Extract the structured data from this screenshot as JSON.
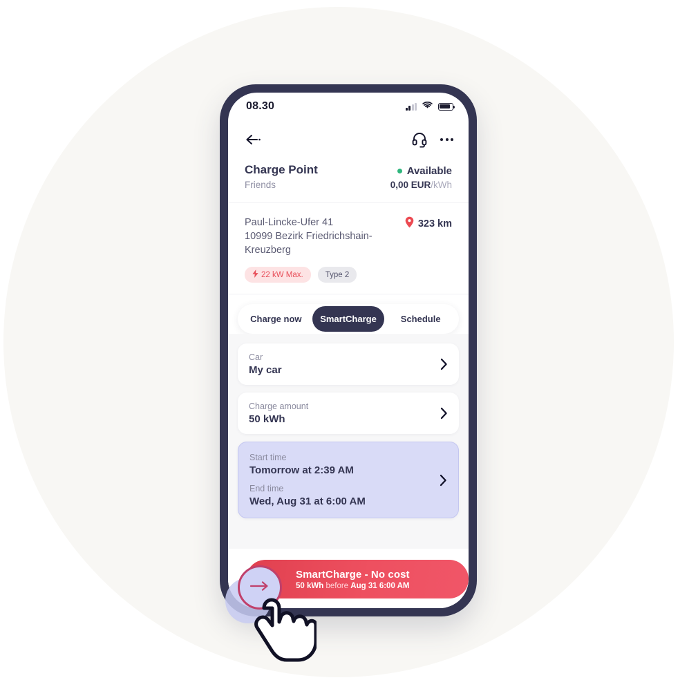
{
  "colors": {
    "backdrop": "#f8f7f4",
    "phone_frame": "#343552",
    "accent_navy": "#343552",
    "accent_red": "#ee5060",
    "available_green": "#2eb67d",
    "highlight_lavender": "#d9dbf7",
    "pill_pink_bg": "#fde3e4",
    "pill_pink_text": "#e8505b",
    "pill_gray_bg": "#e9e9ed",
    "muted_text": "#8a8a9e"
  },
  "status_bar": {
    "time": "08.30",
    "signal_icon": "signal-bars-icon",
    "wifi_icon": "wifi-icon",
    "battery_icon": "battery-icon"
  },
  "navbar": {
    "back_icon": "back-arrow-icon",
    "support_icon": "headset-icon",
    "more_icon": "more-options-icon"
  },
  "header": {
    "title": "Charge Point",
    "subtitle": "Friends",
    "status": "Available",
    "status_dot_icon": "status-dot-icon",
    "price_amount": "0,00 EUR",
    "price_unit": "/kWh"
  },
  "location": {
    "address_line1": "Paul-Lincke-Ufer 41",
    "address_line2": "10999 Bezirk Friedrichshain-",
    "address_line3": "Kreuzberg",
    "distance": "323 km",
    "pin_icon": "map-pin-icon",
    "pills": [
      {
        "label": "22 kW Max.",
        "icon": "lightning-bolt-icon",
        "style": "power"
      },
      {
        "label": "Type 2",
        "icon": "",
        "style": "plug"
      }
    ]
  },
  "tabs": [
    {
      "label": "Charge now",
      "active": false
    },
    {
      "label": "SmartCharge",
      "active": true
    },
    {
      "label": "Schedule",
      "active": false
    }
  ],
  "form": {
    "car": {
      "label": "Car",
      "value": "My car",
      "chevron_icon": "chevron-right-icon"
    },
    "amount": {
      "label": "Charge amount",
      "value": "50 kWh",
      "chevron_icon": "chevron-right-icon"
    },
    "time": {
      "start_label": "Start time",
      "start_value": "Tomorrow at 2:39 AM",
      "end_label": "End time",
      "end_value": "Wed, Aug 31 at 6:00 AM",
      "chevron_icon": "chevron-right-icon"
    }
  },
  "cta": {
    "title": "SmartCharge - No cost",
    "sub_amount": "50 kWh",
    "sub_middle": "before",
    "sub_deadline": "Aug 31 6:00 AM",
    "knob_icon": "arrow-right-icon"
  },
  "cursor": {
    "icon": "hand-pointer-cursor"
  }
}
